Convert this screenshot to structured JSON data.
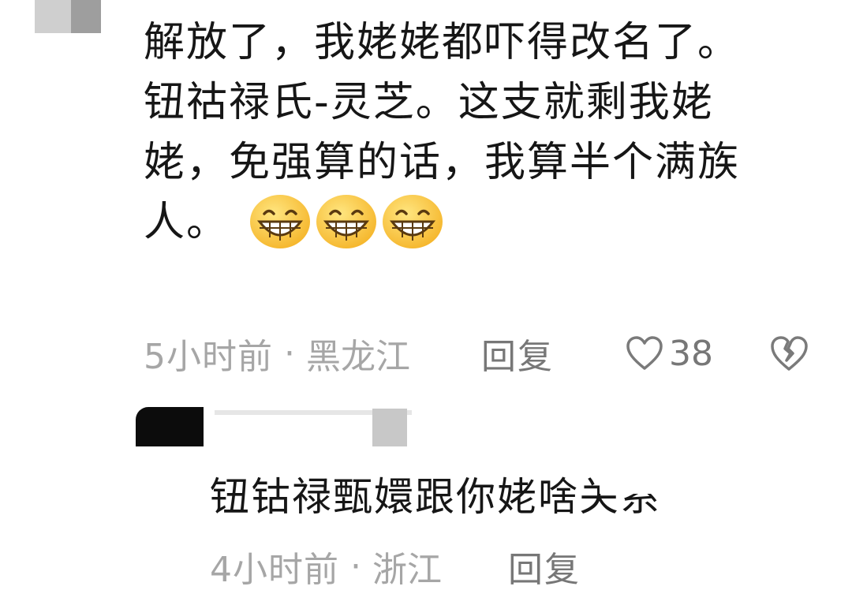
{
  "comment": {
    "lines": [
      "解放了，我姥姥都吓得改名了。",
      "钮祜禄氏-灵芝。这支就剩我姥",
      "姥，免强算的话，我算半个满族",
      "人。"
    ],
    "emoji": [
      "grin-emoji",
      "grin-emoji",
      "grin-emoji"
    ],
    "time": "5小时前",
    "separator": "·",
    "location": "黑龙江",
    "reply_label": "回复",
    "likes": "38"
  },
  "reply": {
    "text": "钮钴禄甄嬛跟你姥啥关系",
    "time": "4小时前",
    "separator": "·",
    "location": "浙江",
    "reply_label": "回复"
  },
  "colors": {
    "text": "#161616",
    "meta": "#a6a6a6",
    "action": "#777777",
    "emoji_face": "#ffd54a"
  }
}
